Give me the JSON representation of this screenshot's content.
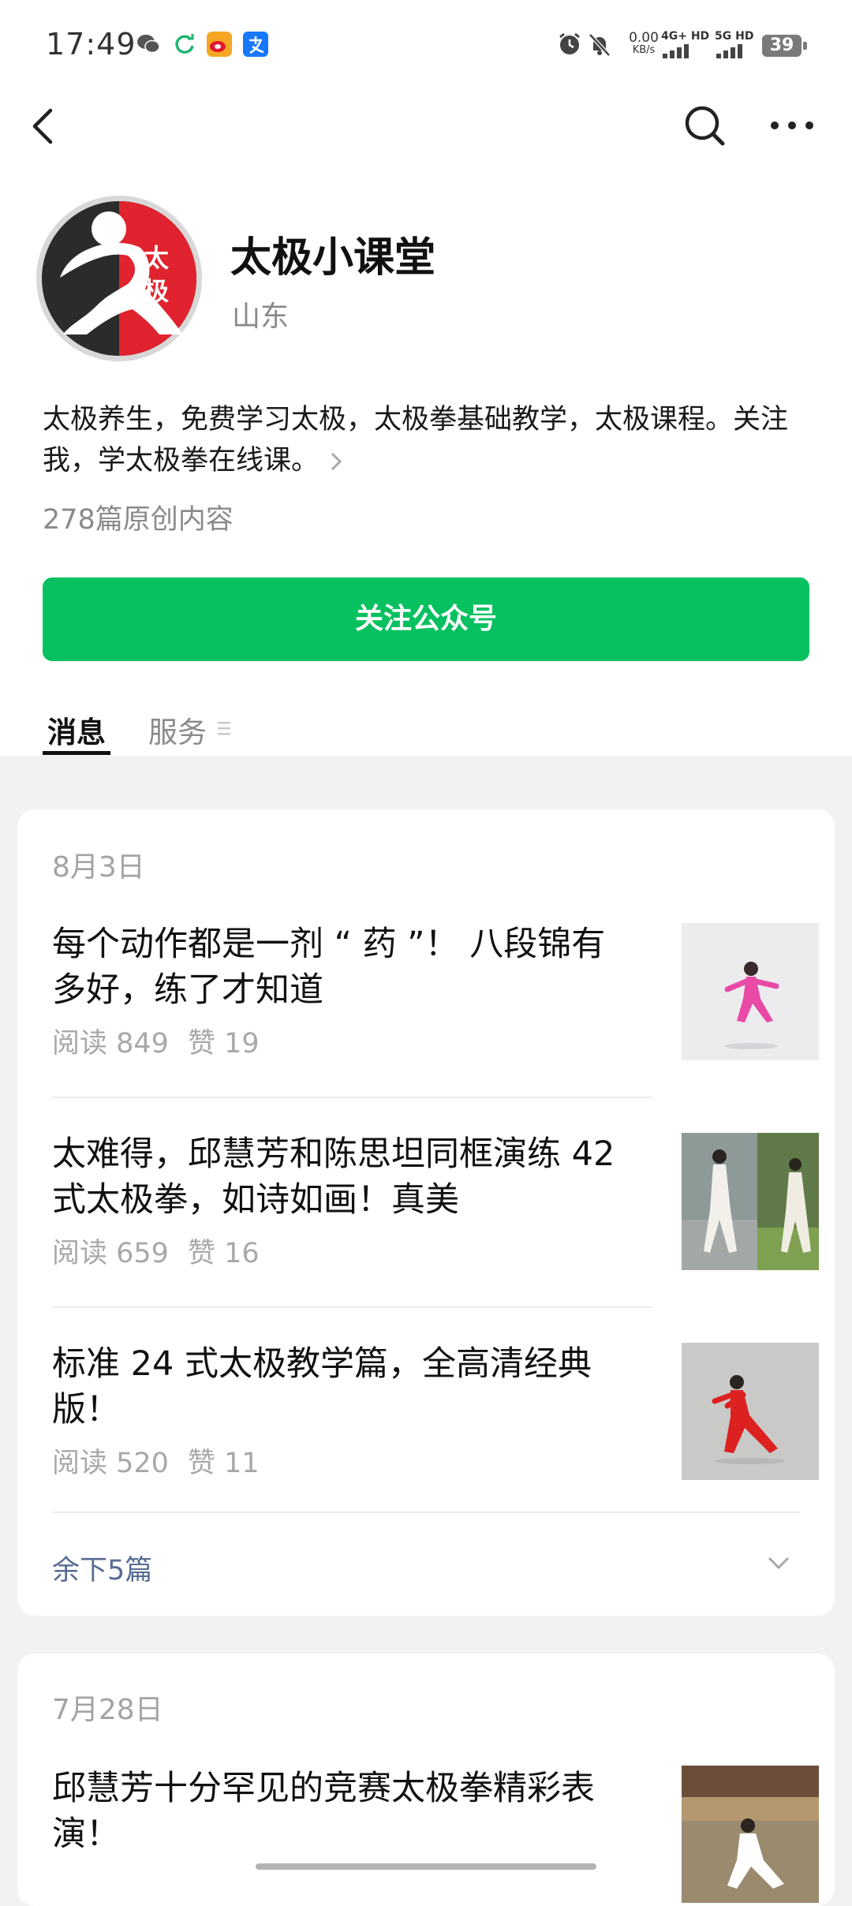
{
  "status_bar": {
    "time": "17:49",
    "net_speed_value": "0.00",
    "net_speed_unit": "KB/s",
    "signal_1": "4G+ HD",
    "signal_2": "5G HD",
    "battery": "39",
    "icons": [
      "wechat-icon",
      "refresh-icon",
      "weibo-icon",
      "alipay-icon",
      "alarm-icon",
      "mute-icon"
    ]
  },
  "nav": {
    "icons": [
      "back-icon",
      "search-icon",
      "more-icon"
    ]
  },
  "profile": {
    "name": "太极小课堂",
    "region": "山东",
    "avatar_text_1": "太",
    "avatar_text_2": "极",
    "bio": "太极养生，免费学习太极，太极拳基础教学，太极课程。关注我，学太极拳在线课。",
    "original_count": "278篇原创内容",
    "follow_label": "关注公众号"
  },
  "tabs": [
    {
      "label": "消息",
      "active": true
    },
    {
      "label": "服务",
      "active": false
    }
  ],
  "groups": [
    {
      "date": "8月3日",
      "articles": [
        {
          "title": "每个动作都是一剂 “ 药 ”！ 八段锦有多好，练了才知道",
          "reads": "阅读 849",
          "likes": "赞 19"
        },
        {
          "title": "太难得，邱慧芳和陈思坦同框演练 42 式太极拳，如诗如画！真美",
          "reads": "阅读 659",
          "likes": "赞 16"
        },
        {
          "title": "标准 24 式太极教学篇，全高清经典版！",
          "reads": "阅读 520",
          "likes": "赞 11"
        }
      ],
      "more_label": "余下5篇"
    },
    {
      "date": "7月28日",
      "articles": [
        {
          "title": "邱慧芳十分罕见的竞赛太极拳精彩表演！"
        }
      ]
    }
  ],
  "colors": {
    "accent_green": "#07c160",
    "link_blue": "#576b95",
    "avatar_red": "#e0232e",
    "avatar_dark": "#2b2b2b"
  }
}
